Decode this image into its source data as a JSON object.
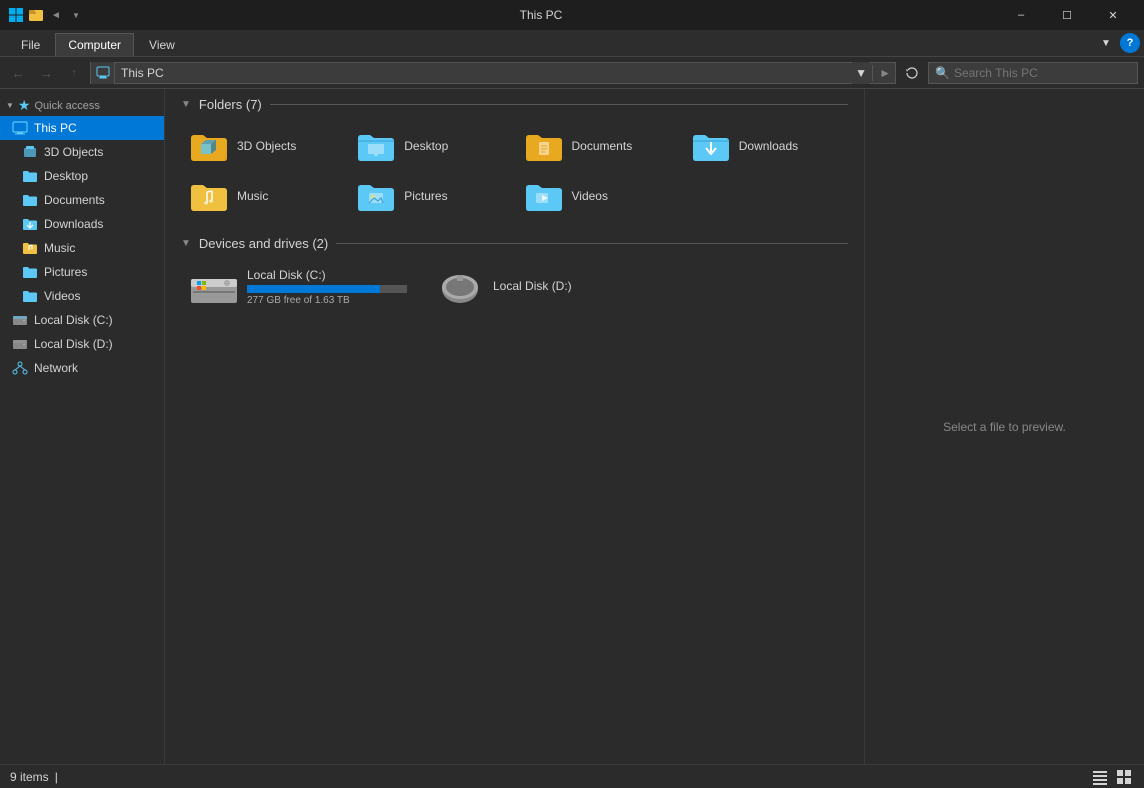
{
  "titleBar": {
    "appName": "This PC",
    "quickAccessIcons": [
      "back",
      "forward"
    ],
    "windowButtons": {
      "minimize": "–",
      "maximize": "☐",
      "close": "✕"
    }
  },
  "ribbon": {
    "tabs": [
      "File",
      "Computer",
      "View"
    ],
    "activeTab": "Computer"
  },
  "addressBar": {
    "path": "This PC",
    "searchPlaceholder": "Search This PC"
  },
  "sidebar": {
    "quickAccess": "Quick access",
    "items": [
      {
        "label": "This PC",
        "type": "thispc",
        "active": true
      },
      {
        "label": "3D Objects",
        "type": "folder3d"
      },
      {
        "label": "Desktop",
        "type": "desktop"
      },
      {
        "label": "Documents",
        "type": "documents"
      },
      {
        "label": "Downloads",
        "type": "downloads"
      },
      {
        "label": "Music",
        "type": "music"
      },
      {
        "label": "Pictures",
        "type": "pictures"
      },
      {
        "label": "Videos",
        "type": "videos"
      },
      {
        "label": "Local Disk (C:)",
        "type": "disk"
      },
      {
        "label": "Local Disk (D:)",
        "type": "disk"
      },
      {
        "label": "Network",
        "type": "network"
      }
    ]
  },
  "content": {
    "foldersSection": {
      "title": "Folders (7)",
      "folders": [
        {
          "name": "3D Objects",
          "type": "3dobjects"
        },
        {
          "name": "Desktop",
          "type": "desktop"
        },
        {
          "name": "Documents",
          "type": "documents"
        },
        {
          "name": "Downloads",
          "type": "downloads"
        },
        {
          "name": "Music",
          "type": "music"
        },
        {
          "name": "Pictures",
          "type": "pictures"
        },
        {
          "name": "Videos",
          "type": "videos"
        }
      ]
    },
    "drivesSection": {
      "title": "Devices and drives (2)",
      "drives": [
        {
          "name": "Local Disk (C:)",
          "freeSpace": "277 GB free of 1.63 TB",
          "usedPercent": 83,
          "type": "c"
        },
        {
          "name": "Local Disk (D:)",
          "freeSpace": "",
          "type": "d"
        }
      ]
    }
  },
  "preview": {
    "text": "Select a file to preview."
  },
  "statusBar": {
    "items": "9 items",
    "separator": "|"
  }
}
